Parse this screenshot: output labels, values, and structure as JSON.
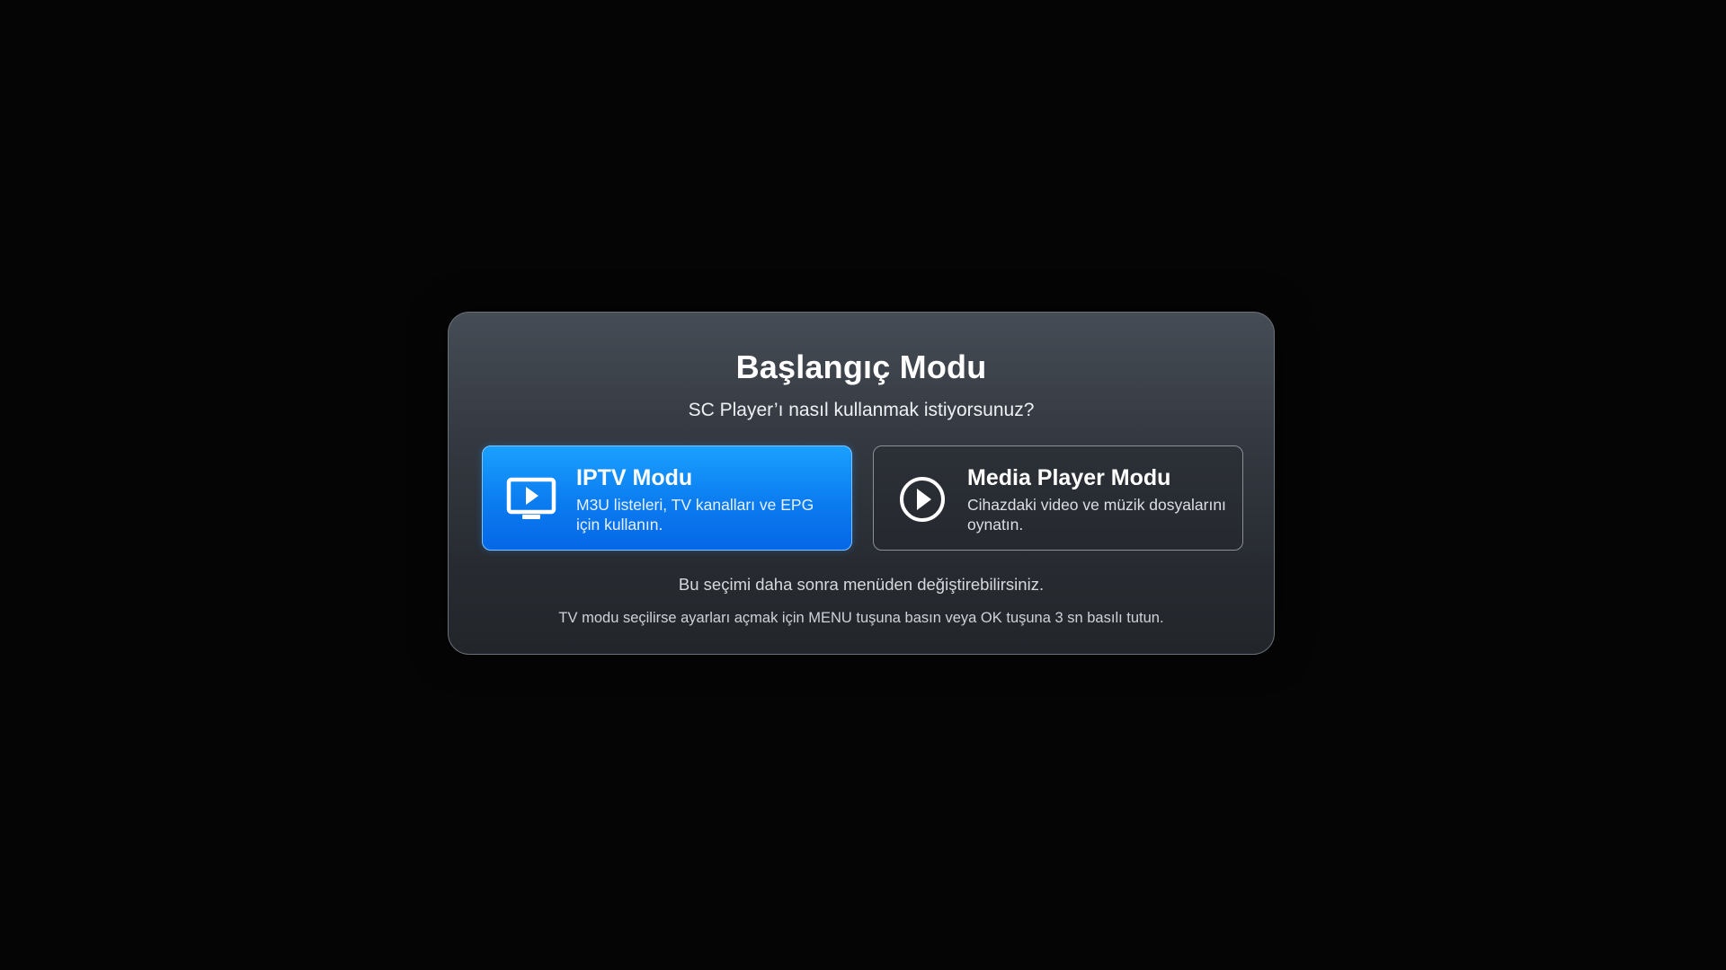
{
  "dialog": {
    "title": "Başlangıç Modu",
    "subtitle": "SC Player’ı nasıl kullanmak istiyorsunuz?",
    "options": [
      {
        "title": "IPTV Modu",
        "description": "M3U listeleri, TV kanalları ve EPG için kullanın.",
        "icon": "tv-play-icon",
        "selected": true,
        "accent": "#0b7cf0"
      },
      {
        "title": "Media Player Modu",
        "description": "Cihazdaki video ve müzik dosyalarını oynatın.",
        "icon": "play-circle-icon",
        "selected": false
      }
    ],
    "note": "Bu seçimi daha sonra menüden değiştirebilirsiniz.",
    "hint": "TV modu seçilirse ayarları açmak için MENU tuşuna basın veya OK tuşuna 3 sn basılı tutun."
  },
  "colors": {
    "background": "#050505",
    "accent": "#0b7cf0"
  }
}
